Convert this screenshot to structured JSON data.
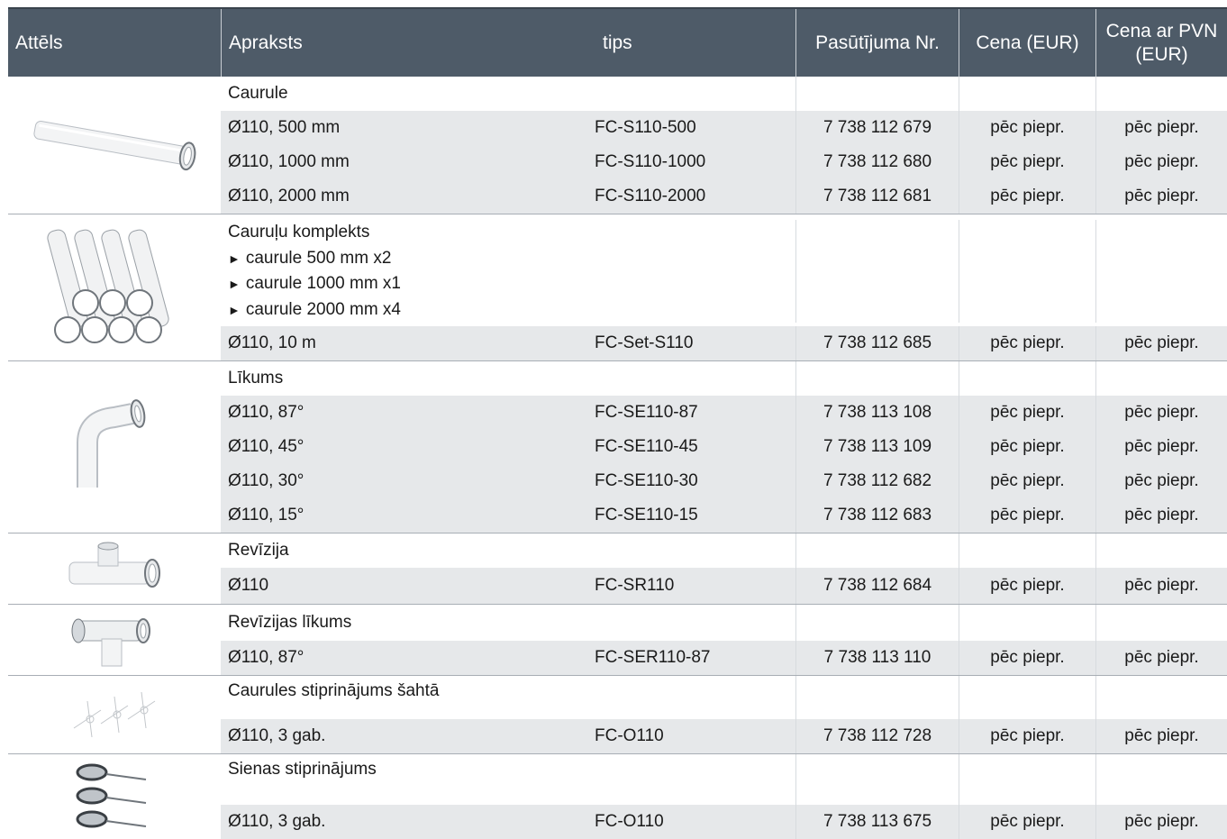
{
  "header": {
    "image": "Attēls",
    "description": "Apraksts",
    "type": "tips",
    "order_no": "Pasūtījuma Nr.",
    "price": "Cena (EUR)",
    "price_vat": "Cena ar PVN (EUR)"
  },
  "groups": [
    {
      "title": "Caurule",
      "image": "pipe-image",
      "rows": [
        {
          "desc": "Ø110, 500 mm",
          "type": "FC-S110-500",
          "order": "7 738 112 679",
          "price": "pēc piepr.",
          "price_vat": "pēc piepr."
        },
        {
          "desc": "Ø110, 1000 mm",
          "type": "FC-S110-1000",
          "order": "7 738 112 680",
          "price": "pēc piepr.",
          "price_vat": "pēc piepr."
        },
        {
          "desc": "Ø110, 2000 mm",
          "type": "FC-S110-2000",
          "order": "7 738 112 681",
          "price": "pēc piepr.",
          "price_vat": "pēc piepr."
        }
      ]
    },
    {
      "title": "Cauruļu komplekts",
      "bullets": [
        "caurule 500 mm x2",
        "caurule 1000 mm x1",
        "caurule 2000 mm x4"
      ],
      "image": "pipe-set-image",
      "rows": [
        {
          "desc": "Ø110, 10 m",
          "type": "FC-Set-S110",
          "order": "7 738 112 685",
          "price": "pēc piepr.",
          "price_vat": "pēc piepr."
        }
      ]
    },
    {
      "title": "Līkums",
      "image": "elbow-image",
      "rows": [
        {
          "desc": "Ø110, 87°",
          "type": "FC-SE110-87",
          "order": "7 738 113 108",
          "price": "pēc piepr.",
          "price_vat": "pēc piepr."
        },
        {
          "desc": "Ø110, 45°",
          "type": "FC-SE110-45",
          "order": "7 738 113 109",
          "price": "pēc piepr.",
          "price_vat": "pēc piepr."
        },
        {
          "desc": "Ø110, 30°",
          "type": "FC-SE110-30",
          "order": "7 738 112 682",
          "price": "pēc piepr.",
          "price_vat": "pēc piepr."
        },
        {
          "desc": "Ø110, 15°",
          "type": "FC-SE110-15",
          "order": "7 738 112 683",
          "price": "pēc piepr.",
          "price_vat": "pēc piepr."
        }
      ]
    },
    {
      "title": "Revīzija",
      "image": "inspection-tee-image",
      "rows": [
        {
          "desc": "Ø110",
          "type": "FC-SR110",
          "order": "7 738 112 684",
          "price": "pēc piepr.",
          "price_vat": "pēc piepr."
        }
      ]
    },
    {
      "title": "Revīzijas līkums",
      "image": "inspection-elbow-image",
      "rows": [
        {
          "desc": "Ø110, 87°",
          "type": "FC-SER110-87",
          "order": "7 738 113 110",
          "price": "pēc piepr.",
          "price_vat": "pēc piepr."
        }
      ]
    },
    {
      "title": "Caurules stiprinājums šahtā",
      "image": "shaft-support-image",
      "rows": [
        {
          "desc": "Ø110, 3 gab.",
          "type": "FC-O110",
          "order": "7 738 112 728",
          "price": "pēc piepr.",
          "price_vat": "pēc piepr."
        }
      ]
    },
    {
      "title": "Sienas stiprinājums",
      "image": "wall-bracket-image",
      "rows": [
        {
          "desc": "Ø110, 3 gab.",
          "type": "FC-O110",
          "order": "7 738 113 675",
          "price": "pēc piepr.",
          "price_vat": "pēc piepr."
        }
      ]
    }
  ],
  "colors": {
    "header_bg": "#4e5b68",
    "row_shade": "#e6e8ea",
    "divider": "#a8aeb5"
  }
}
